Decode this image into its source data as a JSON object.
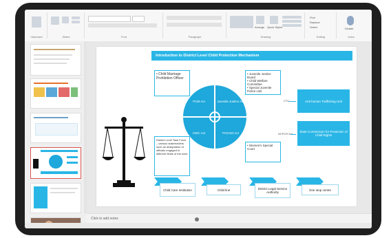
{
  "slide": {
    "title": "Introduction to District Level Child Protection Mechanism",
    "left_box": "• Child Marriage Prohibition Officer",
    "quadrants": [
      "PCM Act",
      "Juvenile Justice Act",
      "CWC Act",
      "POCSO Act"
    ],
    "top_right_list": [
      "• Juvenile Justice Board",
      "• Child Welfare Committee",
      "• Special Juvenile Police Unit"
    ],
    "bottom_left_text": "District Level Task Force – various stakeholders such as designation of officials engaged in different fields of the work",
    "bottom_right_text": "• Women's Special Court",
    "ctu_label": "CTU",
    "ncpcr_label": "NCPCR Act",
    "right_box_1": "Anti human Trafficking Unit",
    "right_box_2": "State Commission for Protection of Child Rights",
    "chevrons": [
      "Child Care Institution",
      "Child line",
      "District Legal Service Authority",
      "One stop centre"
    ]
  },
  "notes_placeholder": "Click to add notes",
  "ribbon_groups": [
    "Clipboard",
    "Slides",
    "Font",
    "Paragraph",
    "Drawing",
    "Editing",
    "Voice"
  ],
  "ribbon_buttons": {
    "arrange": "Arrange",
    "quick_styles": "Quick Styles",
    "dictate": "Dictate",
    "find": "Find",
    "replace": "Replace",
    "select": "Select"
  },
  "colors": {
    "accent": "#29b6e6",
    "circle": "#1ea8db",
    "selected_thumb": "#d9534f"
  }
}
